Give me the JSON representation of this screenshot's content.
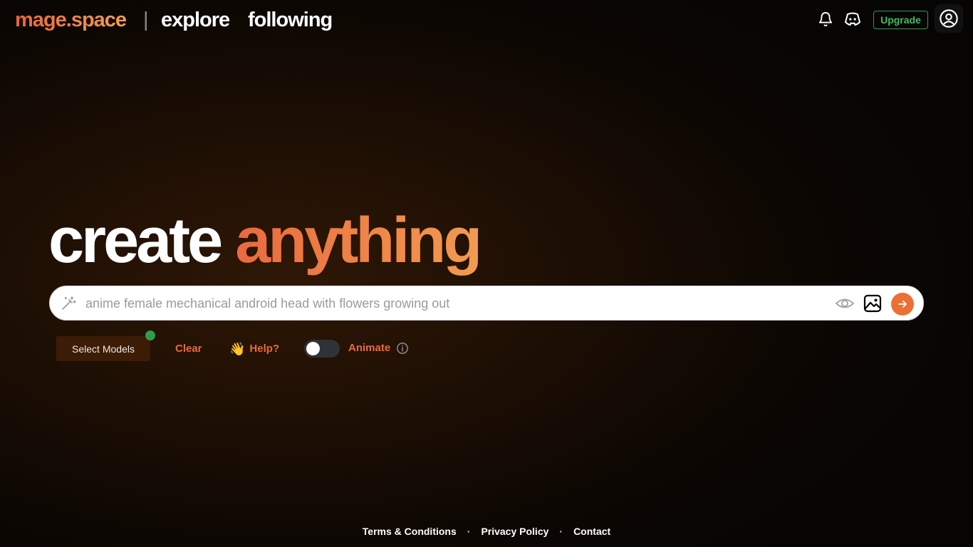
{
  "header": {
    "brand": "mage.space",
    "divider": "|",
    "nav": {
      "explore": "explore",
      "following": "following"
    },
    "upgrade_label": "Upgrade",
    "icons": {
      "notifications": "bell-icon",
      "discord": "discord-icon",
      "account": "user-circle-icon"
    }
  },
  "hero": {
    "title_white": "create",
    "title_accent": "anything"
  },
  "prompt": {
    "value": "",
    "placeholder": "anime female mechanical android head with flowers growing out",
    "icons": [
      "magic-wand-icon",
      "eye-icon",
      "image-icon",
      "arrow-right-icon"
    ]
  },
  "controls": {
    "select_models_label": "Select Models",
    "clear_label": "Clear",
    "help_emoji": "👋",
    "help_label": "Help?",
    "animate_label": "Animate",
    "animate_enabled": false
  },
  "footer": {
    "links": [
      "Terms & Conditions",
      "Privacy Policy",
      "Contact"
    ],
    "separator": "·"
  },
  "colors": {
    "accent_orange": "#e96a3b",
    "accent_gradient_end": "#f29a50",
    "upgrade_green": "#3fbf63",
    "status_green": "#2e9d48",
    "select_models_bg": "#3c1c07",
    "background_dark": "#070503"
  }
}
